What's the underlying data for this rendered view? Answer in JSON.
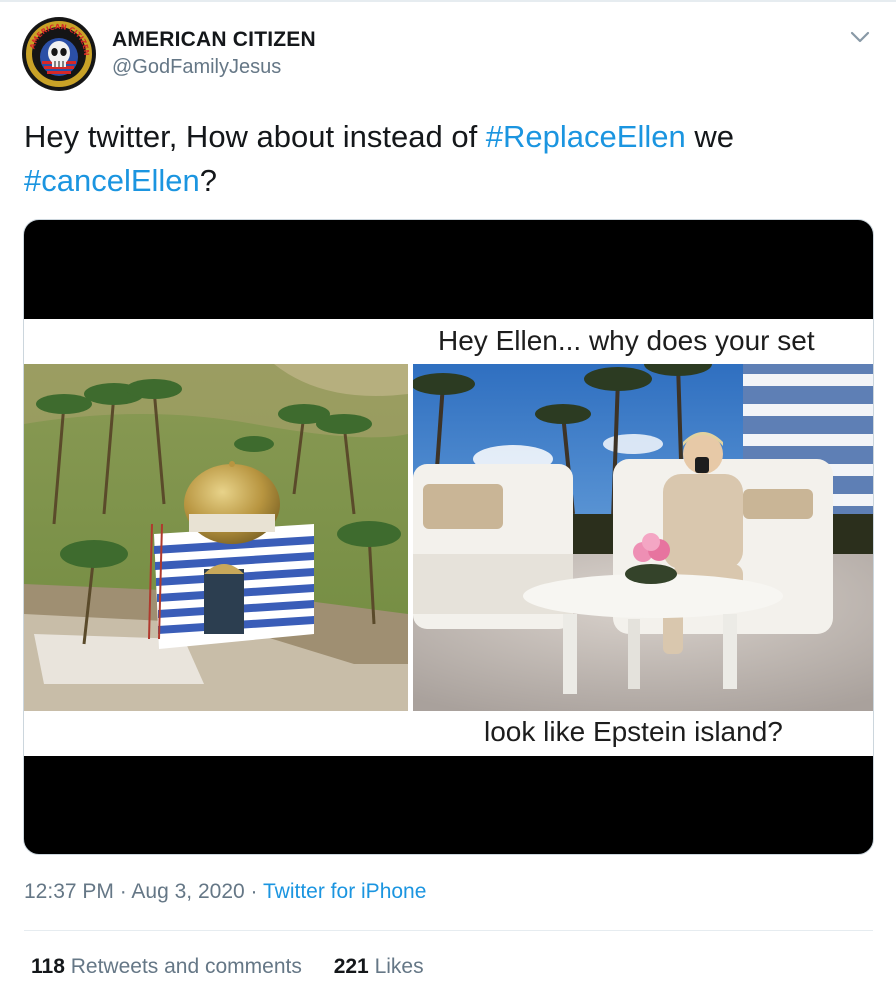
{
  "tweet": {
    "author": {
      "name": "AMERICAN CITIZEN",
      "handle": "@GodFamilyJesus",
      "avatar_text": "AMERICAN CITIZEN"
    },
    "text_parts": {
      "a": "Hey twitter, How about instead of ",
      "tag1": "#ReplaceEllen",
      "b": " we ",
      "tag2": "#cancelEllen",
      "c": "?"
    },
    "media": {
      "caption_top": "Hey Ellen... why does your set",
      "caption_bottom": "look like Epstein island?"
    },
    "time": "12:37 PM",
    "date": "Aug 3, 2020",
    "source": "Twitter for iPhone",
    "separator": "·",
    "retweets_count": "118",
    "retweets_label": "Retweets and comments",
    "likes_count": "221",
    "likes_label": "Likes"
  },
  "colors": {
    "link": "#1b95e0",
    "secondary_text": "#657786",
    "primary_text": "#14171a",
    "border": "#e6ecf0"
  },
  "icons": {
    "menu": "chevron-down-icon"
  }
}
